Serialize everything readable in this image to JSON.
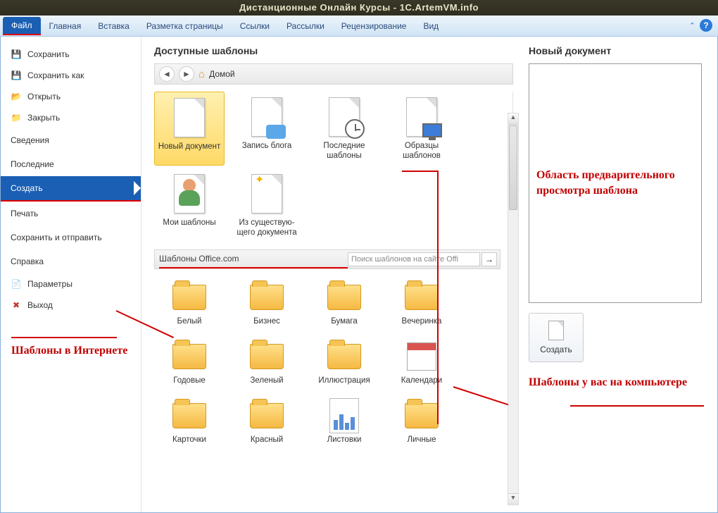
{
  "titlebar": "Дистанционные Онлайн Курсы - 1C.ArtemVM.info",
  "tabs": {
    "file": "Файл",
    "home": "Главная",
    "insert": "Вставка",
    "layout": "Разметка страницы",
    "refs": "Ссылки",
    "mail": "Рассылки",
    "review": "Рецензирование",
    "view": "Вид"
  },
  "sidebar": {
    "save": "Сохранить",
    "saveas": "Сохранить как",
    "open": "Открыть",
    "close": "Закрыть",
    "info": "Сведения",
    "recent": "Последние",
    "new": "Создать",
    "print": "Печать",
    "send": "Сохранить и отправить",
    "help": "Справка",
    "options": "Параметры",
    "exit": "Выход"
  },
  "main": {
    "available_templates": "Доступные шаблоны",
    "home": "Домой",
    "templates": {
      "new_doc": "Новый документ",
      "blog": "Запись блога",
      "recent": "Последние шаблоны",
      "samples": "Образцы шаблонов",
      "my": "Мои шаблоны",
      "existing": "Из существую­щего документа"
    },
    "office_section": "Шаблоны Office.com",
    "search_placeholder": "Поиск шаблонов на сайте Offi",
    "folders": {
      "white": "Белый",
      "business": "Бизнес",
      "paper": "Бумага",
      "party": "Вечеринка",
      "yearly": "Годовые",
      "green": "Зеленый",
      "illustration": "Иллюстрация",
      "calendars": "Календари",
      "cards": "Карточки",
      "red": "Красный",
      "leaflets": "Листовки",
      "personal": "Личные"
    }
  },
  "preview": {
    "title": "Новый документ",
    "create": "Создать"
  },
  "annotations": {
    "internet": "Шаблоны в Интернете",
    "preview_area": "Область предварительного просмотра шаблона",
    "local": "Шаблоны у вас на компьютере"
  }
}
